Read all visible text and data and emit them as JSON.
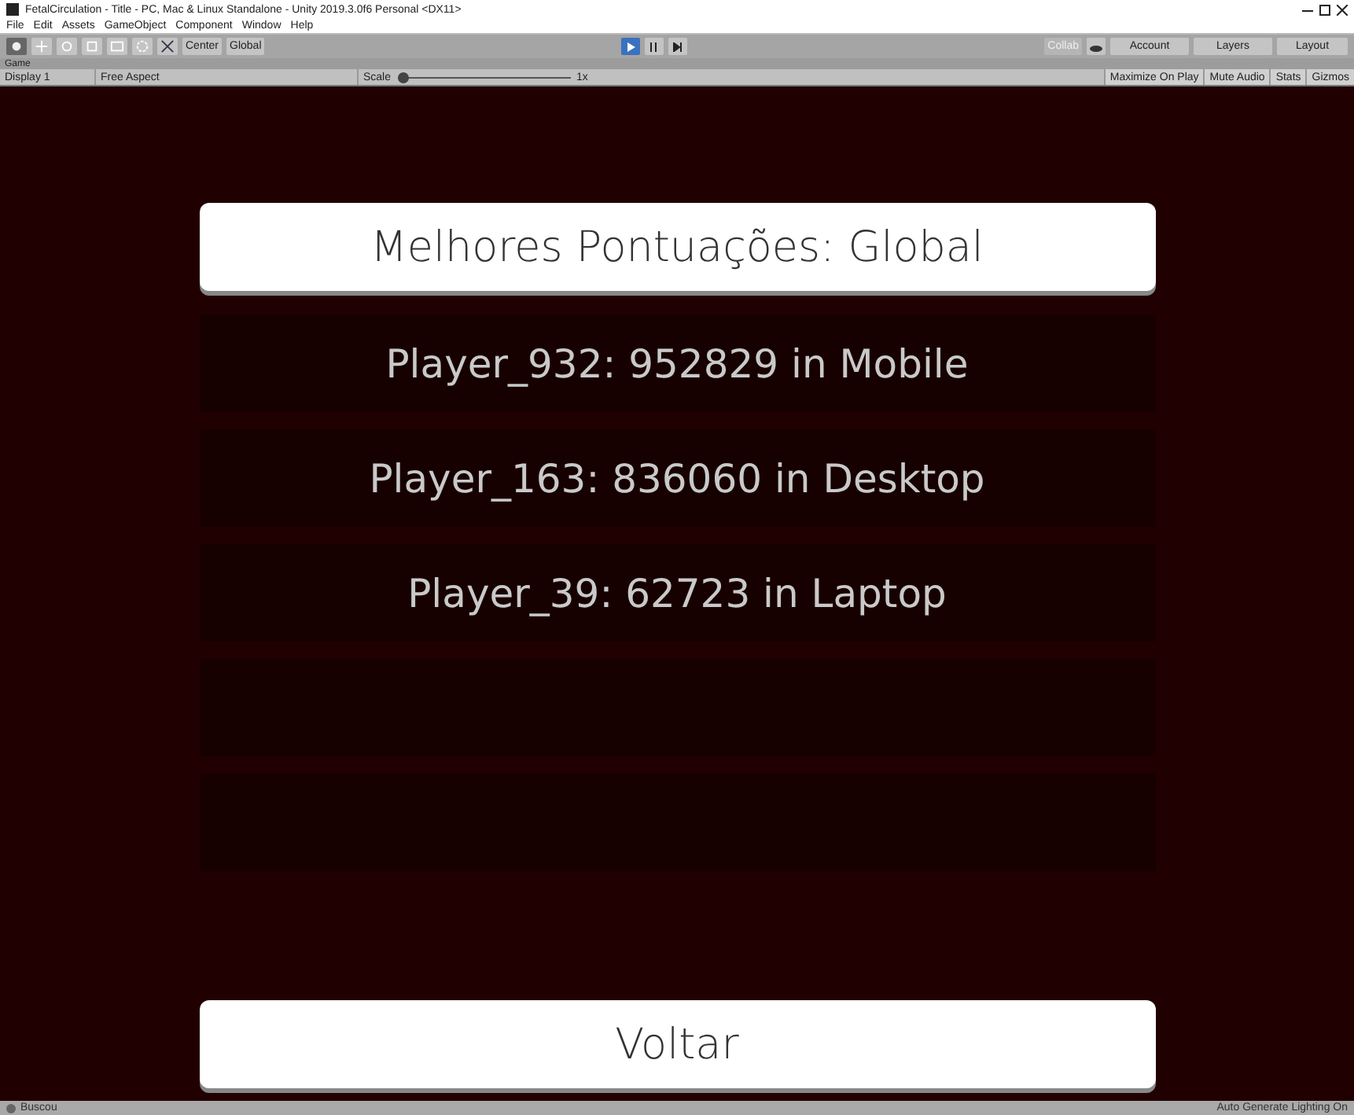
{
  "window": {
    "title": "FetalCirculation - Title - PC, Mac & Linux Standalone - Unity 2019.3.0f6 Personal <DX11>"
  },
  "menu": [
    "File",
    "Edit",
    "Assets",
    "GameObject",
    "Component",
    "Window",
    "Help"
  ],
  "toolbar": {
    "pivot": "Center",
    "space": "Global",
    "play": {
      "selected": true
    },
    "pause": {
      "selected": false
    },
    "step": {
      "selected": false
    },
    "collab": "Collab",
    "account": "Account",
    "layers": "Layers",
    "layout": "Layout"
  },
  "game_tab": {
    "label": "Game"
  },
  "game_toolbar": {
    "display": "Display 1",
    "aspect": "Free Aspect",
    "scale_label": "Scale",
    "scale": {
      "level": 0.0,
      "reading": "1x"
    },
    "options": [
      {
        "label": "Maximize On Play",
        "selected": false
      },
      {
        "label": "Mute Audio",
        "selected": false
      },
      {
        "label": "Stats",
        "selected": false
      },
      {
        "label": "Gizmos",
        "selected": false
      }
    ]
  },
  "game": {
    "header": "Melhores Pontuações: Global",
    "scores": [
      {
        "kind": "entry",
        "text": "Player_932: 952829 in Mobile"
      },
      {
        "kind": "entry",
        "text": "Player_163: 836060 in Desktop"
      },
      {
        "kind": "entry",
        "text": "Player_39: 62723 in Laptop"
      },
      {
        "kind": "empty"
      },
      {
        "kind": "empty"
      }
    ],
    "back_button": "Voltar"
  },
  "status_bar": {
    "message": "Buscou",
    "right": "Auto Generate Lighting On"
  }
}
